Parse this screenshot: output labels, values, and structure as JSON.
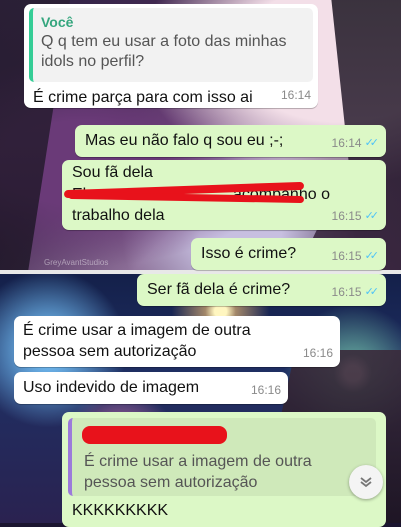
{
  "messages": {
    "m1": {
      "quoted_author": "Você",
      "quoted_text_line1": "Q q tem eu usar a foto das minhas",
      "quoted_text_line2": "idols no perfil?",
      "text": "É crime parça para com isso ai",
      "time": "16:14"
    },
    "m2": {
      "text": "Mas eu não falo q sou eu ;-;",
      "time": "16:14"
    },
    "m3": {
      "line1": "Sou fã dela",
      "line2_start": "Ela",
      "line2_end": "acompanho o",
      "line3": "trabalho dela",
      "time": "16:15"
    },
    "m4": {
      "text": "Isso é crime?",
      "time": "16:15"
    },
    "m5": {
      "text": "Ser fã dela é crime?",
      "time": "16:15"
    },
    "m6": {
      "line1": "É crime usar a imagem de outra",
      "line2": "pessoa sem autorização",
      "time": "16:16"
    },
    "m7": {
      "text": "Uso indevido de imagem",
      "time": "16:16"
    },
    "m8": {
      "quoted_text_line1": "É crime usar a imagem de outra",
      "quoted_text_line2": "pessoa sem autorização",
      "text": "KKKKKKKKK"
    }
  },
  "icons": {
    "read_ticks": "double-check-icon",
    "scroll_down": "double-chevron-down-icon"
  },
  "colors": {
    "outgoing_bubble": "#dcf8c6",
    "incoming_bubble": "#ffffff",
    "read_ticks": "#4fc3f7",
    "quote_bar": "#35cd96",
    "redaction": "#e8121b"
  },
  "watermark": "GreyAvantStudios"
}
